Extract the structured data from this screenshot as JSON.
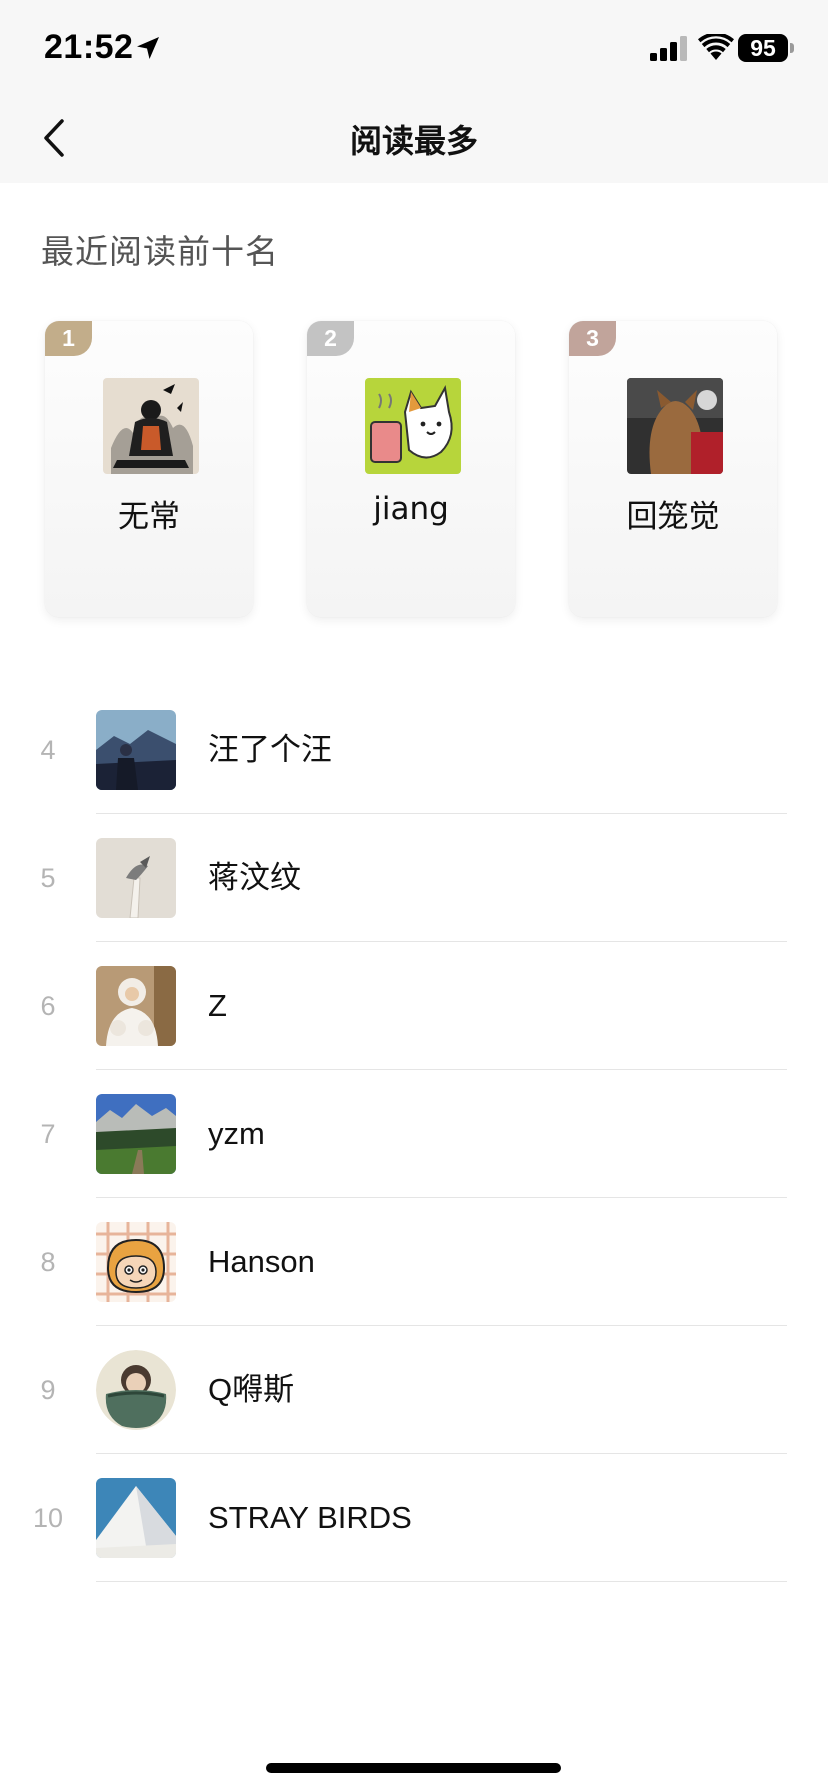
{
  "status_bar": {
    "time": "21:52",
    "battery": "95",
    "icons": [
      "location-arrow-icon",
      "cellular-signal-icon",
      "wifi-icon",
      "battery-icon"
    ]
  },
  "nav": {
    "back_icon": "chevron-left-icon",
    "title": "阅读最多"
  },
  "section": {
    "title": "最近阅读前十名"
  },
  "podium": [
    {
      "rank": "1",
      "name": "无常",
      "badge_color": "#c2ad8a"
    },
    {
      "rank": "2",
      "name": "jiang",
      "badge_color": "#c3c3c3"
    },
    {
      "rank": "3",
      "name": "回笼觉",
      "badge_color": "#c1a49b"
    }
  ],
  "list": [
    {
      "rank": "4",
      "name": "汪了个汪"
    },
    {
      "rank": "5",
      "name": "蒋汶纹"
    },
    {
      "rank": "6",
      "name": "Z"
    },
    {
      "rank": "7",
      "name": "yzm"
    },
    {
      "rank": "8",
      "name": "Hanson"
    },
    {
      "rank": "9",
      "name": "Q嘚斯"
    },
    {
      "rank": "10",
      "name": "STRAY BIRDS"
    }
  ]
}
